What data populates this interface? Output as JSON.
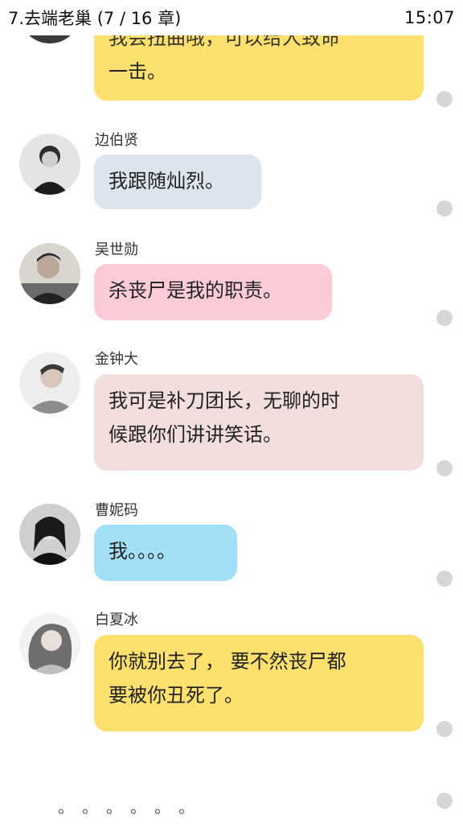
{
  "statusbar": {
    "title": "7.去端老巢 (7 / 16 章)",
    "time": "15:07"
  },
  "colors": {
    "yellow": "#fde06e",
    "gray_blue": "#dce5ed",
    "pink": "#fbccd8",
    "light_rose": "#f3dede",
    "sky_blue": "#a3dff7"
  },
  "messages": [
    {
      "text": "我会扭曲哦，可以给人致命一击。",
      "text_top_line": "我会扭曲哦，可以给人致命",
      "text_line2": "一击。"
    },
    {
      "name": "边伯贤",
      "text": "我跟随灿烈。"
    },
    {
      "name": "吴世勋",
      "text": "杀丧尸是我的职责。"
    },
    {
      "name": "金钟大",
      "text_line1": "我可是补刀团长，无聊的时",
      "text_line2": "候跟你们讲讲笑话。"
    },
    {
      "name": "曹妮码",
      "text": "我。。。。"
    },
    {
      "name": "白夏冰",
      "text_line1": "你就别去了， 要不然丧尸都",
      "text_line2": "要被你丑死了。"
    }
  ],
  "loading": [
    "。",
    "。",
    "。",
    "。",
    "。",
    "。"
  ]
}
